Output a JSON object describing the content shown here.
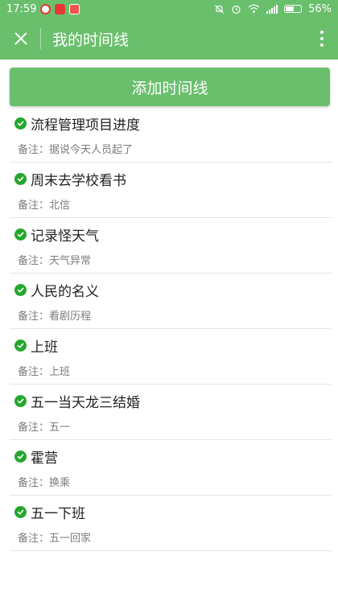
{
  "status_bar": {
    "time": "17:59",
    "battery": "56%"
  },
  "toolbar": {
    "title": "我的时间线"
  },
  "add_button": {
    "label": "添加时间线"
  },
  "note_prefix": "备注：",
  "timeline": [
    {
      "title": "流程管理项目进度",
      "note": "据说今天人员起了"
    },
    {
      "title": "周末去学校看书",
      "note": "北信"
    },
    {
      "title": "记录怪天气",
      "note": "天气异常"
    },
    {
      "title": "人民的名义",
      "note": "看剧历程"
    },
    {
      "title": "上班",
      "note": "上班"
    },
    {
      "title": "五一当天龙三结婚",
      "note": "五一"
    },
    {
      "title": "霍营",
      "note": "换乘"
    },
    {
      "title": "五一下班",
      "note": "五一回家"
    }
  ]
}
